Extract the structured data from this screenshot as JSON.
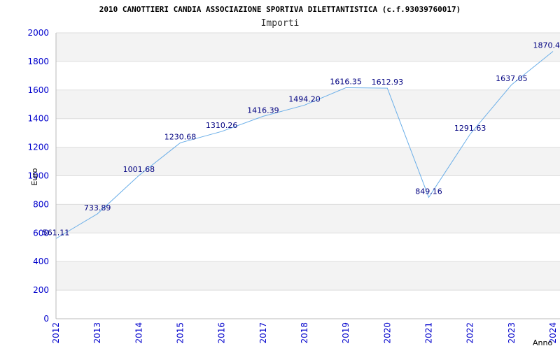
{
  "colors": {
    "line": "#6aaee8",
    "band": "#f3f3f3",
    "grid": "#dddddd",
    "axis": "#bbbbbb",
    "tick_text": "#0000cc",
    "data_label": "#000080"
  },
  "chart_data": {
    "type": "line",
    "title": "2010 CANOTTIERI CANDIA ASSOCIAZIONE SPORTIVA DILETTANTISTICA (c.f.93039760017)",
    "subtitle": "Importi",
    "xlabel": "Anno",
    "ylabel": "Euro",
    "categories": [
      "2012",
      "2013",
      "2014",
      "2015",
      "2016",
      "2017",
      "2018",
      "2019",
      "2020",
      "2021",
      "2022",
      "2023",
      "2024"
    ],
    "values": [
      561.11,
      733.89,
      1001.68,
      1230.68,
      1310.26,
      1416.39,
      1494.2,
      1616.35,
      1612.93,
      849.16,
      1291.63,
      1637.05,
      1870.4
    ],
    "value_labels": [
      "561.11",
      "733.89",
      "1001.68",
      "1230.68",
      "1310.26",
      "1416.39",
      "1494.20",
      "1616.35",
      "1612.93",
      "849.16",
      "1291.63",
      "1637.05",
      "1870.4"
    ],
    "ylim": [
      0,
      2000
    ],
    "yticks": [
      "0",
      "200",
      "400",
      "600",
      "800",
      "1000",
      "1200",
      "1400",
      "1600",
      "1800",
      "2000"
    ],
    "grid": true,
    "legend": "none"
  }
}
